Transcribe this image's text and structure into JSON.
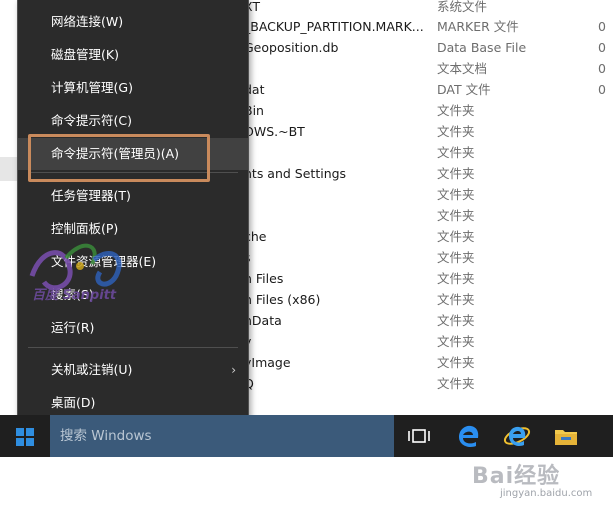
{
  "file_list": {
    "rows": [
      {
        "name": "XT",
        "type": "系统文件",
        "size": ""
      },
      {
        "name": "_BACKUP_PARTITION.MARK...",
        "type": "MARKER 文件",
        "size": "0"
      },
      {
        "name": "Geoposition.db",
        "type": "Data Base File",
        "size": "0"
      },
      {
        "name": "",
        "type": "文本文档",
        "size": "0"
      },
      {
        "name": "dat",
        "type": "DAT 文件",
        "size": "0"
      },
      {
        "name": "Bin",
        "type": "文件夹",
        "size": ""
      },
      {
        "name": "OWS.~BT",
        "type": "文件夹",
        "size": ""
      },
      {
        "name": "",
        "type": "文件夹",
        "size": ""
      },
      {
        "name": "nts and Settings",
        "type": "文件夹",
        "size": ""
      },
      {
        "name": "",
        "type": "文件夹",
        "size": ""
      },
      {
        "name": "",
        "type": "文件夹",
        "size": ""
      },
      {
        "name": "che",
        "type": "文件夹",
        "size": ""
      },
      {
        "name": "s",
        "type": "文件夹",
        "size": ""
      },
      {
        "name": "n Files",
        "type": "文件夹",
        "size": ""
      },
      {
        "name": "n Files (x86)",
        "type": "文件夹",
        "size": ""
      },
      {
        "name": "nData",
        "type": "文件夹",
        "size": ""
      },
      {
        "name": "y",
        "type": "文件夹",
        "size": ""
      },
      {
        "name": "yImage",
        "type": "文件夹",
        "size": ""
      },
      {
        "name": "Q",
        "type": "文件夹",
        "size": ""
      }
    ]
  },
  "menu": {
    "items": [
      {
        "label": "网络连接(W)"
      },
      {
        "label": "磁盘管理(K)"
      },
      {
        "label": "计算机管理(G)"
      },
      {
        "label": "命令提示符(C)"
      },
      {
        "label": "命令提示符(管理员)(A)"
      },
      {
        "label": "任务管理器(T)"
      },
      {
        "label": "控制面板(P)"
      },
      {
        "label": "文件资源管理器(E)"
      },
      {
        "label": "搜索(S)"
      },
      {
        "label": "运行(R)"
      },
      {
        "label": "关机或注销(U)"
      },
      {
        "label": "桌面(D)"
      }
    ],
    "submenu_arrow": "›"
  },
  "taskbar": {
    "search_placeholder": "搜索 Windows"
  },
  "watermarks": {
    "logo_text": "百度 Sanpitt",
    "baidu_big": "Bai经验",
    "baidu_small": "jingyan.baidu.com"
  },
  "colors": {
    "menu_bg": "#2b2b2b",
    "highlight_border": "#c98a5c",
    "taskbar_bg": "#1f1f1f",
    "search_bg": "#3b5a7a",
    "windows_blue": "#1e90ff"
  }
}
